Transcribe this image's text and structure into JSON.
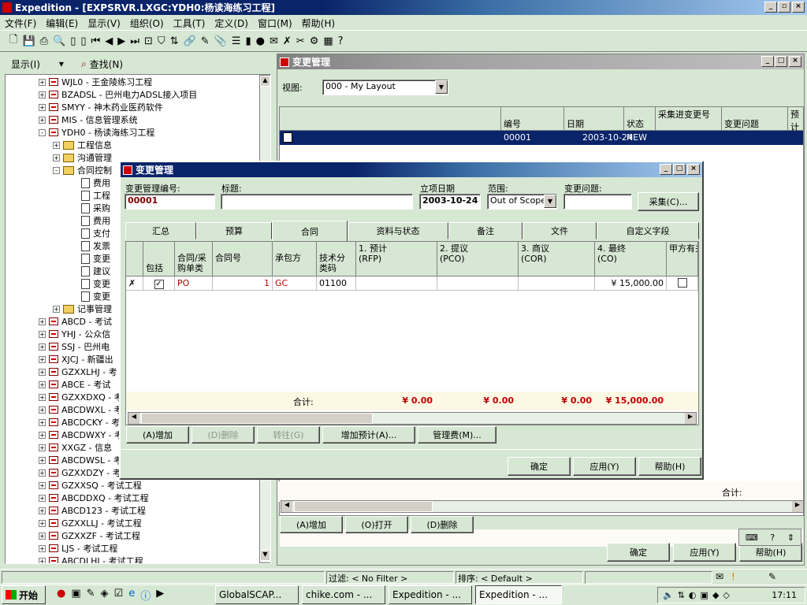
{
  "app_title": "Expedition - [EXPSRVR.LXGC:YDH0:杨读海练习工程]",
  "menu": [
    "文件(F)",
    "编辑(E)",
    "显示(V)",
    "组织(O)",
    "工具(T)",
    "定义(D)",
    "窗口(M)",
    "帮助(H)"
  ],
  "left_toolbar": {
    "view_label": "显示(I)",
    "find_label": "查找(N)"
  },
  "tree": {
    "projects_top": [
      "WJL0 - 王金陵练习工程",
      "BZADSL - 巴州电力ADSL接入项目",
      "SMYY - 神木药业医药软件",
      "MIS - 信息管理系统",
      "YDH0 - 杨读海练习工程"
    ],
    "folders": [
      "工程信息",
      "沟通管理",
      "合同控制"
    ],
    "docs": [
      "费用",
      "工程",
      "采购",
      "费用",
      "支付",
      "发票",
      "变更",
      "建议",
      "变更",
      "变更"
    ],
    "folder_after": "记事管理",
    "projects_bottom": [
      "ABCD - 考试",
      "YHJ - 公众信",
      "SSJ - 巴州电",
      "XJCJ - 新疆出",
      "GZXXLHJ - 考",
      "ABCE - 考试",
      "GZXXDXQ - 考",
      "ABCDWXL - 考",
      "ABCDCKY - 考",
      "ABCDWXY - 考",
      "XXGZ - 信息",
      "ABCDWSL - 考",
      "GZXXDZY - 考",
      "GZXXSQ - 考试工程",
      "ABCDDXQ - 考试工程",
      "ABCD123 - 考试工程",
      "GZXXLLJ - 考试工程",
      "GZXXZF - 考试工程",
      "LJS - 考试工程",
      "ABCDLHJ - 考试工程"
    ]
  },
  "bg_window": {
    "title": "变更管理",
    "view_label": "视图:",
    "view_value": "000 - My Layout",
    "columns": [
      "编号",
      "日期",
      "状态",
      "采集进变更号",
      "变更问题",
      "预计"
    ],
    "row": {
      "no": "00001",
      "date": "2003-10-24",
      "status": "NEW"
    },
    "total_label": "合计:",
    "buttons": {
      "add": "(A)增加",
      "open": "(O)打开",
      "del": "(D)删除",
      "ok": "确定",
      "apply": "应用(Y)",
      "help": "帮助(H)"
    }
  },
  "dialog": {
    "title": "变更管理",
    "labels": {
      "no": "变更管理编号:",
      "title": "标题:",
      "date": "立项日期",
      "scope": "范围:",
      "issue": "变更问题:"
    },
    "values": {
      "no": "00001",
      "title": "",
      "date": "2003-10-24",
      "scope": "Out of Scope",
      "issue": ""
    },
    "collect_button": "采集(C)...",
    "tabs": [
      "汇总",
      "预算",
      "合同",
      "资料与状态",
      "备注",
      "文件",
      "自定义字段"
    ],
    "grid_headers": [
      "包括",
      "合同/采购单类",
      "合同号",
      "承包方",
      "技术分类码",
      "1. 预计\n(RFP)",
      "2. 提议\n(PCO)",
      "3. 商议\n(COR)",
      "4. 最终\n(CO)",
      "甲方有关"
    ],
    "row": {
      "include": "✓",
      "type": "PO",
      "contract_no": "1",
      "contractor": "GC",
      "tech_code": "01100",
      "rfp": "",
      "pco": "",
      "cor": "",
      "co": "¥ 15,000.00"
    },
    "totals": {
      "label": "合计:",
      "rfp": "¥ 0.00",
      "pco": "¥ 0.00",
      "cor": "¥ 0.00",
      "co": "¥ 15,000.00"
    },
    "bottom_buttons": {
      "add": "(A)增加",
      "del": "(D)删除",
      "goto": "转往(G)",
      "add_est": "增加预计(A)...",
      "mgmt": "管理费(M)..."
    },
    "footer_buttons": {
      "ok": "确定",
      "apply": "应用(Y)",
      "help": "帮助(H)"
    }
  },
  "statusbar": {
    "filter": "过滤: < No Filter >",
    "sort": "排序: < Default >"
  },
  "taskbar": {
    "start": "开始",
    "tasks": [
      "GlobalSCAP...",
      "chike.com - ...",
      "Expedition - ...",
      "Expedition - ..."
    ],
    "clock": "17:11"
  },
  "colors": {
    "title_active": "#0a246a",
    "highlight": "#0a246a",
    "dialog_bg": "#d6e7d3",
    "money_red": "#c00000"
  }
}
